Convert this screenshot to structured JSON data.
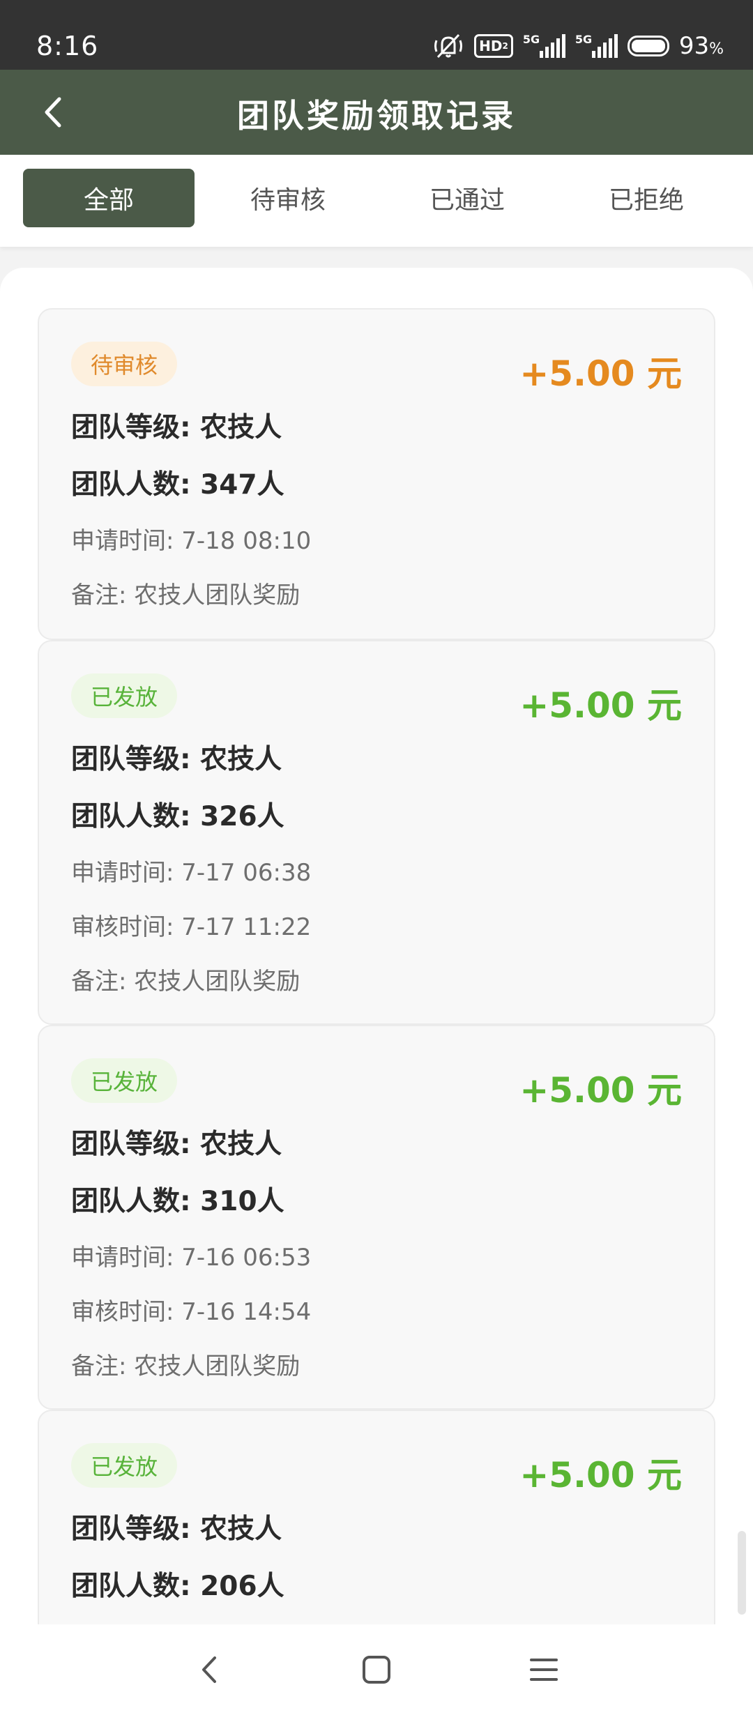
{
  "status_bar": {
    "time": "8:16",
    "network_badge": "HD",
    "network_badge_sub": "2",
    "signal1_label": "5G",
    "signal2_label": "5G",
    "battery_percent": "93",
    "battery_unit": "%",
    "icons": [
      "mute-vibrate-icon",
      "hd-icon",
      "signal-icon",
      "signal-icon",
      "battery-icon"
    ]
  },
  "header": {
    "title": "团队奖励领取记录",
    "back_icon": "chevron-left-icon",
    "background": "#4b5a48"
  },
  "tabs": [
    {
      "label": "全部",
      "active": true
    },
    {
      "label": "待审核",
      "active": false
    },
    {
      "label": "已通过",
      "active": false
    },
    {
      "label": "已拒绝",
      "active": false
    }
  ],
  "records": [
    {
      "status": "待审核",
      "amount": "+5.00 元",
      "level": "团队等级: 农技人",
      "members": "团队人数: 347人",
      "apply_time": "申请时间: 7-18 08:10",
      "note": "备注: 农技人团队奖励"
    },
    {
      "status": "已发放",
      "amount": "+5.00 元",
      "level": "团队等级: 农技人",
      "members": "团队人数: 326人",
      "apply_time": "申请时间: 7-17 06:38",
      "review_time": "审核时间: 7-17 11:22",
      "note": "备注: 农技人团队奖励"
    },
    {
      "status": "已发放",
      "amount": "+5.00 元",
      "level": "团队等级: 农技人",
      "members": "团队人数: 310人",
      "apply_time": "申请时间: 7-16 06:53",
      "review_time": "审核时间: 7-16 14:54",
      "note": "备注: 农技人团队奖励"
    },
    {
      "status": "已发放",
      "amount": "+5.00 元",
      "level": "团队等级: 农技人",
      "members": "团队人数: 206人"
    }
  ],
  "colors": {
    "pending": "#e58a1f",
    "done": "#5ab533"
  },
  "nav": {
    "icons": [
      "back-icon",
      "home-icon",
      "menu-icon"
    ]
  }
}
